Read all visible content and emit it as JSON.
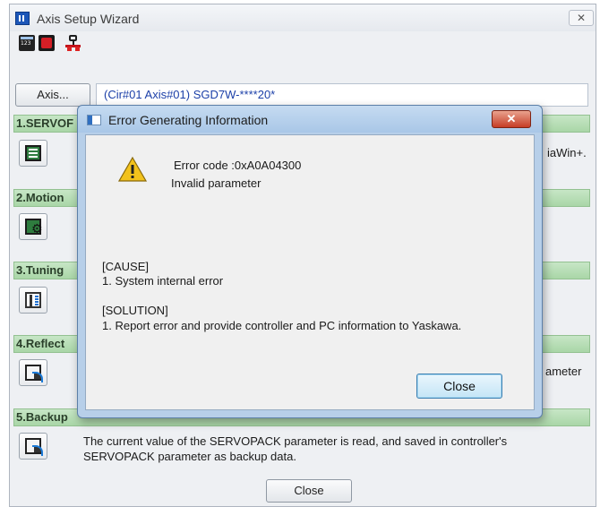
{
  "window": {
    "title": "Axis Setup Wizard",
    "close_glyph": "✕"
  },
  "toolbar": {
    "icons": [
      "calculator-icon",
      "record-icon",
      "network-icon"
    ]
  },
  "axis": {
    "button_label": "Axis...",
    "value": "(Cir#01 Axis#01) SGD7W-****20*"
  },
  "sections": [
    {
      "label": "1.SERVOF",
      "text": "iaWin+.",
      "icon": "monitor-icon"
    },
    {
      "label": "2.Motion",
      "text": "",
      "icon": "gear-icon"
    },
    {
      "label": "3.Tuning",
      "text": "",
      "icon": "tuning-icon"
    },
    {
      "label": "4.Reflect",
      "text": "ameter",
      "icon": "reflect-icon"
    },
    {
      "label": "5.Backup",
      "text_line1": "The current value of the SERVOPACK parameter is read, and saved in controller's",
      "text_line2": "SERVOPACK parameter as backup data.",
      "icon": "backup-icon"
    }
  ],
  "main_close_label": "Close",
  "dialog": {
    "title": "Error Generating Information",
    "close_glyph": "✕",
    "error_code": "Error code :0xA0A04300",
    "error_message": "Invalid parameter",
    "cause_heading": "[CAUSE]",
    "cause_item": "1. System internal error",
    "solution_heading": "[SOLUTION]",
    "solution_item": "1. Report error and provide controller and PC information to Yaskawa.",
    "close_label": "Close"
  }
}
